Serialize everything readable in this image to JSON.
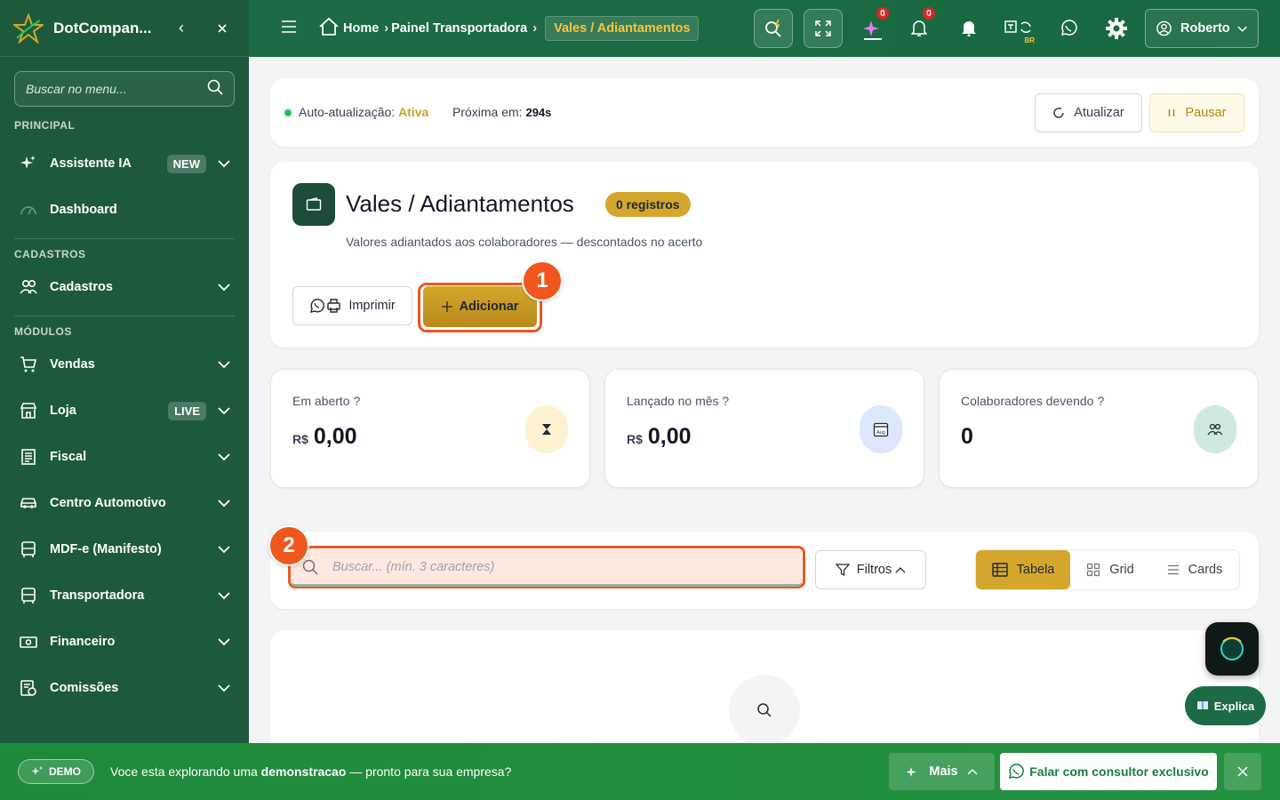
{
  "sidebar": {
    "brand": "DotCompan...",
    "search_placeholder": "Buscar no menu...",
    "sections": {
      "principal": "PRINCIPAL",
      "cadastros": "CADASTROS",
      "modulos": "MÓDULOS"
    },
    "items": {
      "assistente": {
        "label": "Assistente IA",
        "badge": "NEW"
      },
      "dashboard": {
        "label": "Dashboard"
      },
      "cadastros": {
        "label": "Cadastros"
      },
      "vendas": {
        "label": "Vendas"
      },
      "loja": {
        "label": "Loja",
        "badge": "LIVE"
      },
      "fiscal": {
        "label": "Fiscal"
      },
      "automotivo": {
        "label": "Centro Automotivo"
      },
      "mdfe": {
        "label": "MDF-e (Manifesto)"
      },
      "transportadora": {
        "label": "Transportadora"
      },
      "financeiro": {
        "label": "Financeiro"
      },
      "comissoes": {
        "label": "Comissões"
      }
    }
  },
  "topbar": {
    "breadcrumb": {
      "home": "Home",
      "parent": "Painel Transportadora",
      "current": "Vales / Adiantamentos"
    },
    "ai_count": "0",
    "notif_count": "0",
    "lang": "BR",
    "user": "Roberto"
  },
  "auto_update": {
    "label": "Auto-atualização:",
    "status": "Ativa",
    "next_label": "Próxima em:",
    "next_value": "294s",
    "refresh_label": "Atualizar",
    "pause_label": "Pausar"
  },
  "page": {
    "title": "Vales / Adiantamentos",
    "count_badge": "0 registros",
    "subtitle": "Valores adiantados aos colaboradores — descontados no acerto",
    "print_label": "Imprimir",
    "add_label": "Adicionar",
    "marker1": "1",
    "marker2": "2"
  },
  "stats": [
    {
      "label": "Em aberto ?",
      "currency": "R$",
      "value": "0,00"
    },
    {
      "label": "Lançado no mês ?",
      "currency": "R$",
      "value": "0,00",
      "icon_text": "Aug"
    },
    {
      "label": "Colaboradores devendo ?",
      "currency": "",
      "value": "0"
    }
  ],
  "list": {
    "search_placeholder": "Buscar... (mín. 3 caracteres)",
    "filters_label": "Filtros",
    "views": {
      "table": "Tabela",
      "grid": "Grid",
      "cards": "Cards"
    }
  },
  "fab": {
    "explica": "Explica"
  },
  "banner": {
    "demo": "DEMO",
    "msg_start": "Voce esta explorando uma",
    "msg_bold": "demonstracao",
    "msg_end": "— pronto para sua empresa?",
    "more": "Mais",
    "consultor": "Falar com consultor exclusivo"
  },
  "colors": {
    "sidebar": "#1d5a3c",
    "topbar": "#1d6b45",
    "accent_gold": "#d4a72c",
    "highlight": "#f0561d",
    "banner": "#1f8a3b"
  }
}
